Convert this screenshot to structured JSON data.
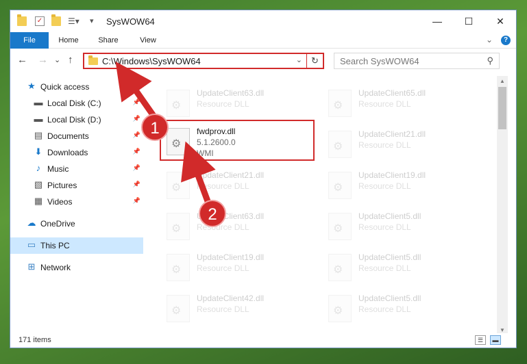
{
  "window": {
    "title": "SysWOW64",
    "controls": {
      "minimize": "—",
      "maximize": "☐",
      "close": "✕"
    }
  },
  "ribbon": {
    "tabs": [
      "File",
      "Home",
      "Share",
      "View"
    ],
    "expand_glyph": "⌄",
    "help_glyph": "?"
  },
  "navigation": {
    "back": "←",
    "forward": "→",
    "recent": "⌄",
    "up": "↑",
    "address": "C:\\Windows\\SysWOW64",
    "address_dropdown": "⌄",
    "refresh": "↻",
    "search_placeholder": "Search SysWOW64",
    "search_icon": "⚲"
  },
  "sidebar": {
    "items": [
      {
        "label": "Quick access",
        "icon": "star-icon",
        "glyph": "★",
        "pinned": false
      },
      {
        "label": "Local Disk (C:)",
        "icon": "drive-icon",
        "glyph": "▬",
        "pinned": true
      },
      {
        "label": "Local Disk (D:)",
        "icon": "drive-icon",
        "glyph": "▬",
        "pinned": true
      },
      {
        "label": "Documents",
        "icon": "documents-icon",
        "glyph": "▤",
        "pinned": true
      },
      {
        "label": "Downloads",
        "icon": "download-icon",
        "glyph": "⬇",
        "pinned": true
      },
      {
        "label": "Music",
        "icon": "music-icon",
        "glyph": "♪",
        "pinned": true
      },
      {
        "label": "Pictures",
        "icon": "pictures-icon",
        "glyph": "▧",
        "pinned": true
      },
      {
        "label": "Videos",
        "icon": "video-icon",
        "glyph": "▦",
        "pinned": true
      },
      {
        "label": "OneDrive",
        "icon": "cloud-icon",
        "glyph": "☁",
        "pinned": false
      },
      {
        "label": "This PC",
        "icon": "computer-icon",
        "glyph": "▭",
        "pinned": false,
        "selected": true
      },
      {
        "label": "Network",
        "icon": "network-icon",
        "glyph": "⊞",
        "pinned": false
      }
    ],
    "pin_glyph": "📌"
  },
  "files": {
    "highlighted": {
      "name": "fwdprov.dll",
      "version": "5.1.2600.0",
      "description": "WMI"
    },
    "background": [
      {
        "name": "UpdateClient63.dll",
        "type": "Resource DLL"
      },
      {
        "name": "UpdateClient65.dll",
        "type": "Resource DLL"
      },
      {
        "name": "UpdateClient21.dll",
        "type": "Resource DLL"
      },
      {
        "name": "UpdateClient21.dll",
        "type": "Resource DLL"
      },
      {
        "name": "UpdateClient19.dll",
        "type": "Resource DLL"
      },
      {
        "name": "UpdateClient63.dll",
        "type": "Resource DLL"
      },
      {
        "name": "UpdateClient5.dll",
        "type": "Resource DLL"
      },
      {
        "name": "UpdateClient19.dll",
        "type": "Resource DLL"
      },
      {
        "name": "UpdateClient5.dll",
        "type": "Resource DLL"
      },
      {
        "name": "UpdateClient42.dll",
        "type": "Resource DLL"
      },
      {
        "name": "UpdateClient5.dll",
        "type": "Resource DLL"
      }
    ]
  },
  "annotations": {
    "step1": "1",
    "step2": "2",
    "color": "#d12a2a"
  },
  "status": {
    "item_count": "171 items"
  },
  "colors": {
    "accent": "#1979ca",
    "selection": "#cde8ff",
    "highlight": "#d12a2a"
  }
}
